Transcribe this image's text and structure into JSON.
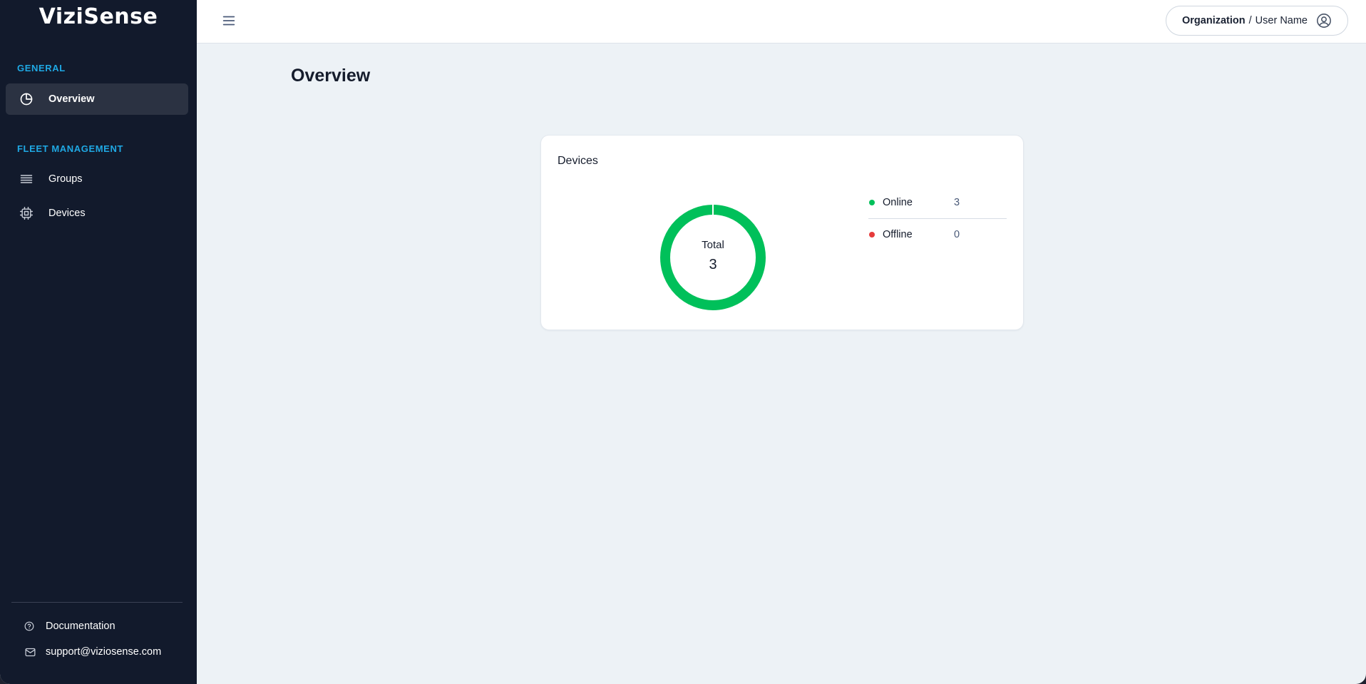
{
  "brand": {
    "name": "ViziSense"
  },
  "sidebar": {
    "sections": [
      {
        "title": "GENERAL"
      },
      {
        "title": "FLEET MANAGEMENT"
      }
    ],
    "items": [
      {
        "label": "Overview",
        "icon": "pie-chart-icon",
        "active": true
      },
      {
        "label": "Groups",
        "icon": "list-icon",
        "active": false
      },
      {
        "label": "Devices",
        "icon": "chip-icon",
        "active": false
      }
    ],
    "footer": [
      {
        "label": "Documentation",
        "icon": "help-circle-icon"
      },
      {
        "label": "support@viziosense.com",
        "icon": "mail-icon"
      }
    ]
  },
  "header": {
    "menu_icon": "hamburger-menu-icon",
    "organization": "Organization",
    "separator": "/",
    "user_name": "User Name",
    "user_icon": "user-circle-icon"
  },
  "main": {
    "title": "Overview",
    "devices_card": {
      "title": "Devices",
      "total_label": "Total",
      "total_value": "3",
      "legend": [
        {
          "label": "Online",
          "value": "3",
          "color": "#00c05a"
        },
        {
          "label": "Offline",
          "value": "0",
          "color": "#e63b3b"
        }
      ]
    }
  },
  "colors": {
    "sidebar_bg": "#121a2c",
    "accent_section": "#1fa8e3",
    "online": "#00c05a",
    "offline": "#e63b3b",
    "page_bg": "#edf2f6"
  }
}
